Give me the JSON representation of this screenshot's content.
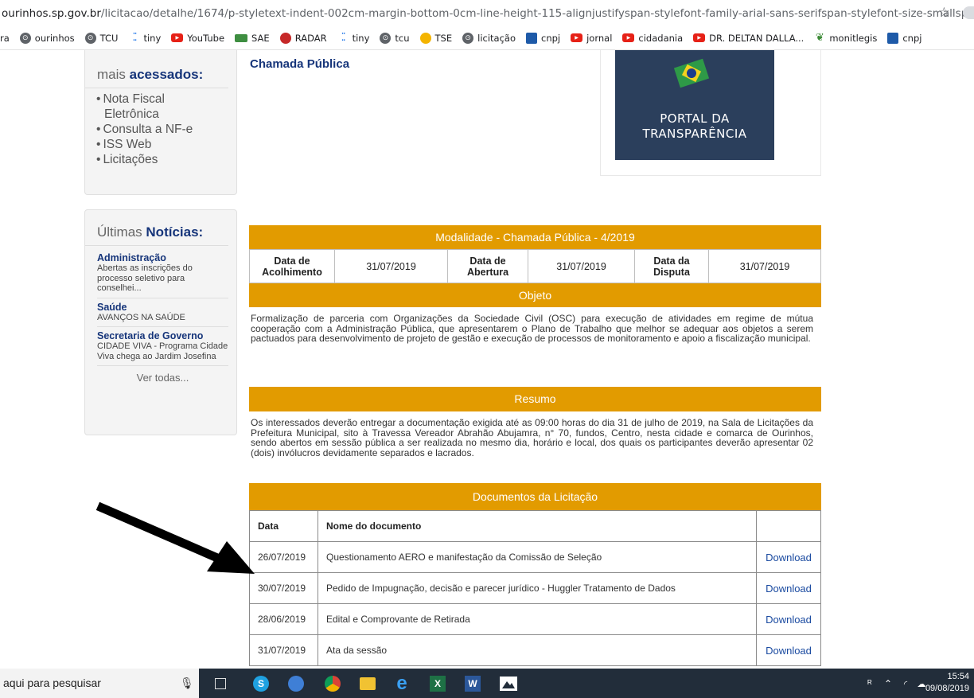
{
  "browser": {
    "url_host": "ourinhos.sp.gov.br",
    "url_path": "/licitacao/detalhe/1674/p-styletext-indent-002cm-margin-bottom-0cm-line-height-115-alignjustifyspan-stylefont-family-arial-sans-serifspan-stylefont-size-smallspan-style...",
    "bookmarks": [
      {
        "label": "ra",
        "icon": "none"
      },
      {
        "label": "ourinhos",
        "icon": "globe-icon"
      },
      {
        "label": "TCU",
        "icon": "globe-icon"
      },
      {
        "label": "tiny",
        "icon": "tiny-icon"
      },
      {
        "label": "YouTube",
        "icon": "youtube-icon"
      },
      {
        "label": "SAE",
        "icon": "sae-icon"
      },
      {
        "label": "RADAR",
        "icon": "radar-icon"
      },
      {
        "label": "tiny",
        "icon": "tiny-icon"
      },
      {
        "label": "tcu",
        "icon": "globe-icon"
      },
      {
        "label": "TSE",
        "icon": "tse-icon"
      },
      {
        "label": "licitação",
        "icon": "globe-icon"
      },
      {
        "label": "cnpj",
        "icon": "cnpj-icon"
      },
      {
        "label": "jornal",
        "icon": "youtube-icon"
      },
      {
        "label": "cidadania",
        "icon": "youtube-icon"
      },
      {
        "label": "DR. DELTAN DALLA...",
        "icon": "youtube-icon"
      },
      {
        "label": "monitlegis",
        "icon": "leaf-icon"
      },
      {
        "label": "cnpj",
        "icon": "cnpj-icon"
      }
    ]
  },
  "sidebar": {
    "most_accessed": {
      "title_prefix": "mais",
      "title_bold": "acessados:",
      "items": [
        {
          "line1": "Nota Fiscal",
          "line2": "Eletrônica"
        },
        {
          "line1": "Consulta a NF-e",
          "line2": ""
        },
        {
          "line1": "ISS Web",
          "line2": ""
        },
        {
          "line1": "Licitações",
          "line2": ""
        }
      ]
    },
    "news": {
      "title_prefix": "Últimas",
      "title_bold": "Notícias:",
      "items": [
        {
          "category": "Administração",
          "text": "Abertas as inscrições do processo seletivo para conselhei..."
        },
        {
          "category": "Saúde",
          "text": "AVANÇOS NA SAÚDE"
        },
        {
          "category": "Secretaria de Governo",
          "text": "CIDADE VIVA - Programa Cidade Viva chega ao Jardim Josefina"
        }
      ],
      "see_all": "Ver todas..."
    }
  },
  "main": {
    "title": "Chamada Pública",
    "portal": {
      "line1": "PORTAL DA",
      "line2": "TRANSPARÊNCIA"
    },
    "modalidade": "Modalidade - Chamada Pública - 4/2019",
    "dates": {
      "acolhimento_label": "Data de Acolhimento",
      "acolhimento_value": "31/07/2019",
      "abertura_label": "Data de Abertura",
      "abertura_value": "31/07/2019",
      "disputa_label": "Data da Disputa",
      "disputa_value": "31/07/2019"
    },
    "objeto_header": "Objeto",
    "objeto_text": "Formalização de parceria com Organizações da Sociedade Civil (OSC) para execução de atividades em regime de mútua cooperação com a Administração Pública, que apresentarem o Plano de Trabalho que melhor se adequar aos objetos a serem pactuados para desenvolvimento de projeto de gestão e execução de processos de monitoramento e apoio a fiscalização municipal.",
    "resumo_header": "Resumo",
    "resumo_text": "Os interessados deverão entregar a documentação exigida até as 09:00 horas do dia 31 de julho de 2019, na Sala de Licitações da Prefeitura Municipal, sito à Travessa Vereador Abrahão Abujamra, n° 70, fundos, Centro, nesta cidade e comarca de Ourinhos, sendo abertos em sessão pública a ser realizada no mesmo dia, horário e local, dos quais os participantes deverão apresentar 02 (dois) invólucros devidamente separados e lacrados.",
    "docs_header": "Documentos da Licitação",
    "docs_columns": [
      "Data",
      "Nome do documento",
      ""
    ],
    "docs": [
      {
        "date": "26/07/2019",
        "name": "Questionamento AERO e manifestação da Comissão de Seleção",
        "link": "Download"
      },
      {
        "date": "30/07/2019",
        "name": "Pedido de Impugnação, decisão e parecer jurídico - Huggler Tratamento de Dados",
        "link": "Download"
      },
      {
        "date": "28/06/2019",
        "name": "Edital e Comprovante de Retirada",
        "link": "Download"
      },
      {
        "date": "31/07/2019",
        "name": "Ata da sessão",
        "link": "Download"
      }
    ]
  },
  "taskbar": {
    "search_placeholder": "aqui para pesquisar",
    "time": "15:54",
    "date": "09/08/2019"
  },
  "colors": {
    "accent_bar": "#e29b00",
    "title_blue": "#16357a",
    "link_blue": "#1a4aa0",
    "portal_bg": "#2b3f5c",
    "taskbar_bg": "#222d3a"
  }
}
